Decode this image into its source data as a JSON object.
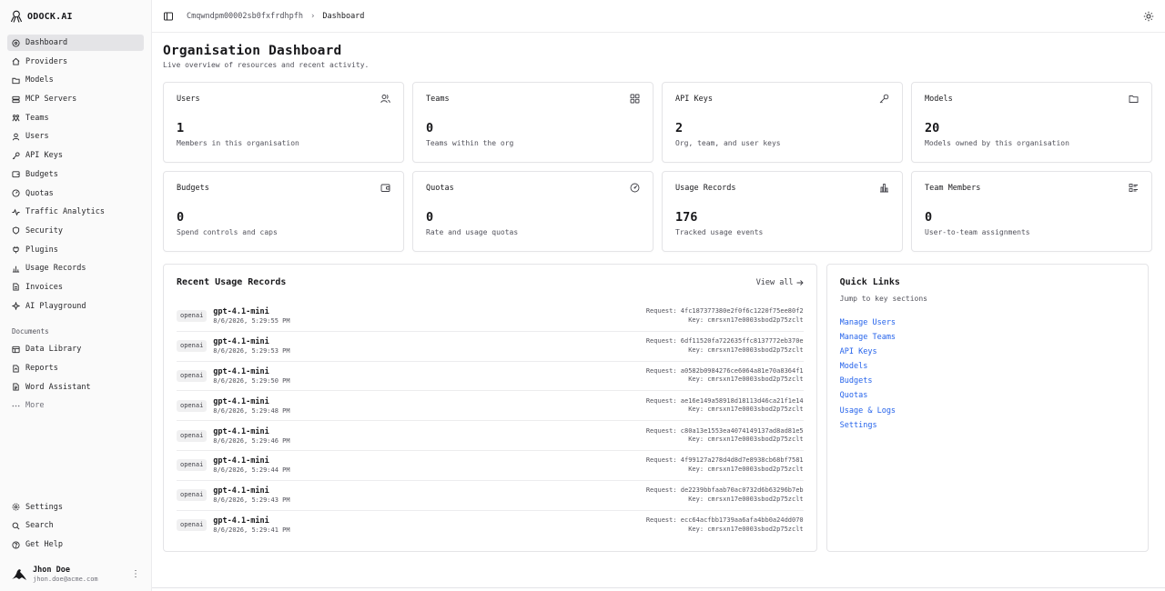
{
  "brand": {
    "name": "ODOCK.AI"
  },
  "nav": {
    "items": [
      {
        "label": "Dashboard",
        "icon": "dashboard-icon",
        "active": true
      },
      {
        "label": "Providers",
        "icon": "home-icon"
      },
      {
        "label": "Models",
        "icon": "folder-icon"
      },
      {
        "label": "MCP Servers",
        "icon": "server-icon"
      },
      {
        "label": "Teams",
        "icon": "team-icon"
      },
      {
        "label": "Users",
        "icon": "user-icon"
      },
      {
        "label": "API Keys",
        "icon": "key-icon"
      },
      {
        "label": "Budgets",
        "icon": "wallet-icon"
      },
      {
        "label": "Quotas",
        "icon": "gauge-icon"
      },
      {
        "label": "Traffic Analytics",
        "icon": "activity-icon"
      },
      {
        "label": "Security",
        "icon": "shield-icon"
      },
      {
        "label": "Plugins",
        "icon": "plug-icon"
      },
      {
        "label": "Usage Records",
        "icon": "bar-chart-icon"
      },
      {
        "label": "Invoices",
        "icon": "file-icon"
      },
      {
        "label": "AI Playground",
        "icon": "sparkle-icon"
      }
    ],
    "documents_label": "Documents",
    "documents": [
      {
        "label": "Data Library",
        "icon": "database-icon"
      },
      {
        "label": "Reports",
        "icon": "report-icon"
      },
      {
        "label": "Word Assistant",
        "icon": "document-icon"
      }
    ],
    "more_label": "More",
    "bottom": [
      {
        "label": "Settings",
        "icon": "gear-icon"
      },
      {
        "label": "Search",
        "icon": "search-icon"
      },
      {
        "label": "Get Help",
        "icon": "help-icon"
      }
    ],
    "user": {
      "name": "Jhon Doe",
      "email": "jhon.doe@acme.com",
      "menu": "⋮"
    }
  },
  "topbar": {
    "org": "Cmqwndpm00002sb0fxfrdhpfh",
    "current": "Dashboard",
    "separator": "›"
  },
  "page": {
    "title": "Organisation Dashboard",
    "subtitle": "Live overview of resources and recent activity."
  },
  "stats": [
    {
      "label": "Users",
      "value": "1",
      "desc": "Members in this organisation",
      "icon": "users-icon"
    },
    {
      "label": "Teams",
      "value": "0",
      "desc": "Teams within the org",
      "icon": "grid-icon"
    },
    {
      "label": "API Keys",
      "value": "2",
      "desc": "Org, team, and user keys",
      "icon": "key-icon"
    },
    {
      "label": "Models",
      "value": "20",
      "desc": "Models owned by this organisation",
      "icon": "folder-icon"
    },
    {
      "label": "Budgets",
      "value": "0",
      "desc": "Spend controls and caps",
      "icon": "wallet-icon"
    },
    {
      "label": "Quotas",
      "value": "0",
      "desc": "Rate and usage quotas",
      "icon": "gauge-icon"
    },
    {
      "label": "Usage Records",
      "value": "176",
      "desc": "Tracked usage events",
      "icon": "bar-chart-icon"
    },
    {
      "label": "Team Members",
      "value": "0",
      "desc": "User-to-team assignments",
      "icon": "list-check-icon"
    }
  ],
  "records": {
    "title": "Recent Usage Records",
    "view_all": "View all",
    "request_prefix": "Request:",
    "key_prefix": "Key:",
    "rows": [
      {
        "provider": "openai",
        "model": "gpt-4.1-mini",
        "time": "8/6/2026, 5:29:55 PM",
        "request": "4fc187377380e2f0f6c1220f75ee80f2",
        "key": "cmrsxn17e0003sbod2p75zclt"
      },
      {
        "provider": "openai",
        "model": "gpt-4.1-mini",
        "time": "8/6/2026, 5:29:53 PM",
        "request": "6df11520fa722635ffc8137772eb370e",
        "key": "cmrsxn17e0003sbod2p75zclt"
      },
      {
        "provider": "openai",
        "model": "gpt-4.1-mini",
        "time": "8/6/2026, 5:29:50 PM",
        "request": "a0582b0984276ce6064a81e70a8364f1",
        "key": "cmrsxn17e0003sbod2p75zclt"
      },
      {
        "provider": "openai",
        "model": "gpt-4.1-mini",
        "time": "8/6/2026, 5:29:48 PM",
        "request": "ae16e149a58918d18113d46ca21f1e14",
        "key": "cmrsxn17e0003sbod2p75zclt"
      },
      {
        "provider": "openai",
        "model": "gpt-4.1-mini",
        "time": "8/6/2026, 5:29:46 PM",
        "request": "c80a13e1553ea4074149137ad8ad81e5",
        "key": "cmrsxn17e0003sbod2p75zclt"
      },
      {
        "provider": "openai",
        "model": "gpt-4.1-mini",
        "time": "8/6/2026, 5:29:44 PM",
        "request": "4f99127a278d4d8d7e8938cb68bf7581",
        "key": "cmrsxn17e0003sbod2p75zclt"
      },
      {
        "provider": "openai",
        "model": "gpt-4.1-mini",
        "time": "8/6/2026, 5:29:43 PM",
        "request": "de2239bbfaab70ac0732d6b63296b7eb",
        "key": "cmrsxn17e0003sbod2p75zclt"
      },
      {
        "provider": "openai",
        "model": "gpt-4.1-mini",
        "time": "8/6/2026, 5:29:41 PM",
        "request": "ecc64acfbb1739aa6afa4bb0a24dd070",
        "key": "cmrsxn17e0003sbod2p75zclt"
      }
    ]
  },
  "quick_links": {
    "title": "Quick Links",
    "subtitle": "Jump to key sections",
    "links": [
      "Manage Users",
      "Manage Teams",
      "API Keys",
      "Models",
      "Budgets",
      "Quotas",
      "Usage & Logs",
      "Settings"
    ]
  },
  "colors": {
    "link": "#2563eb",
    "active_nav": "#e4e4e7",
    "border": "#e4e4e7"
  }
}
